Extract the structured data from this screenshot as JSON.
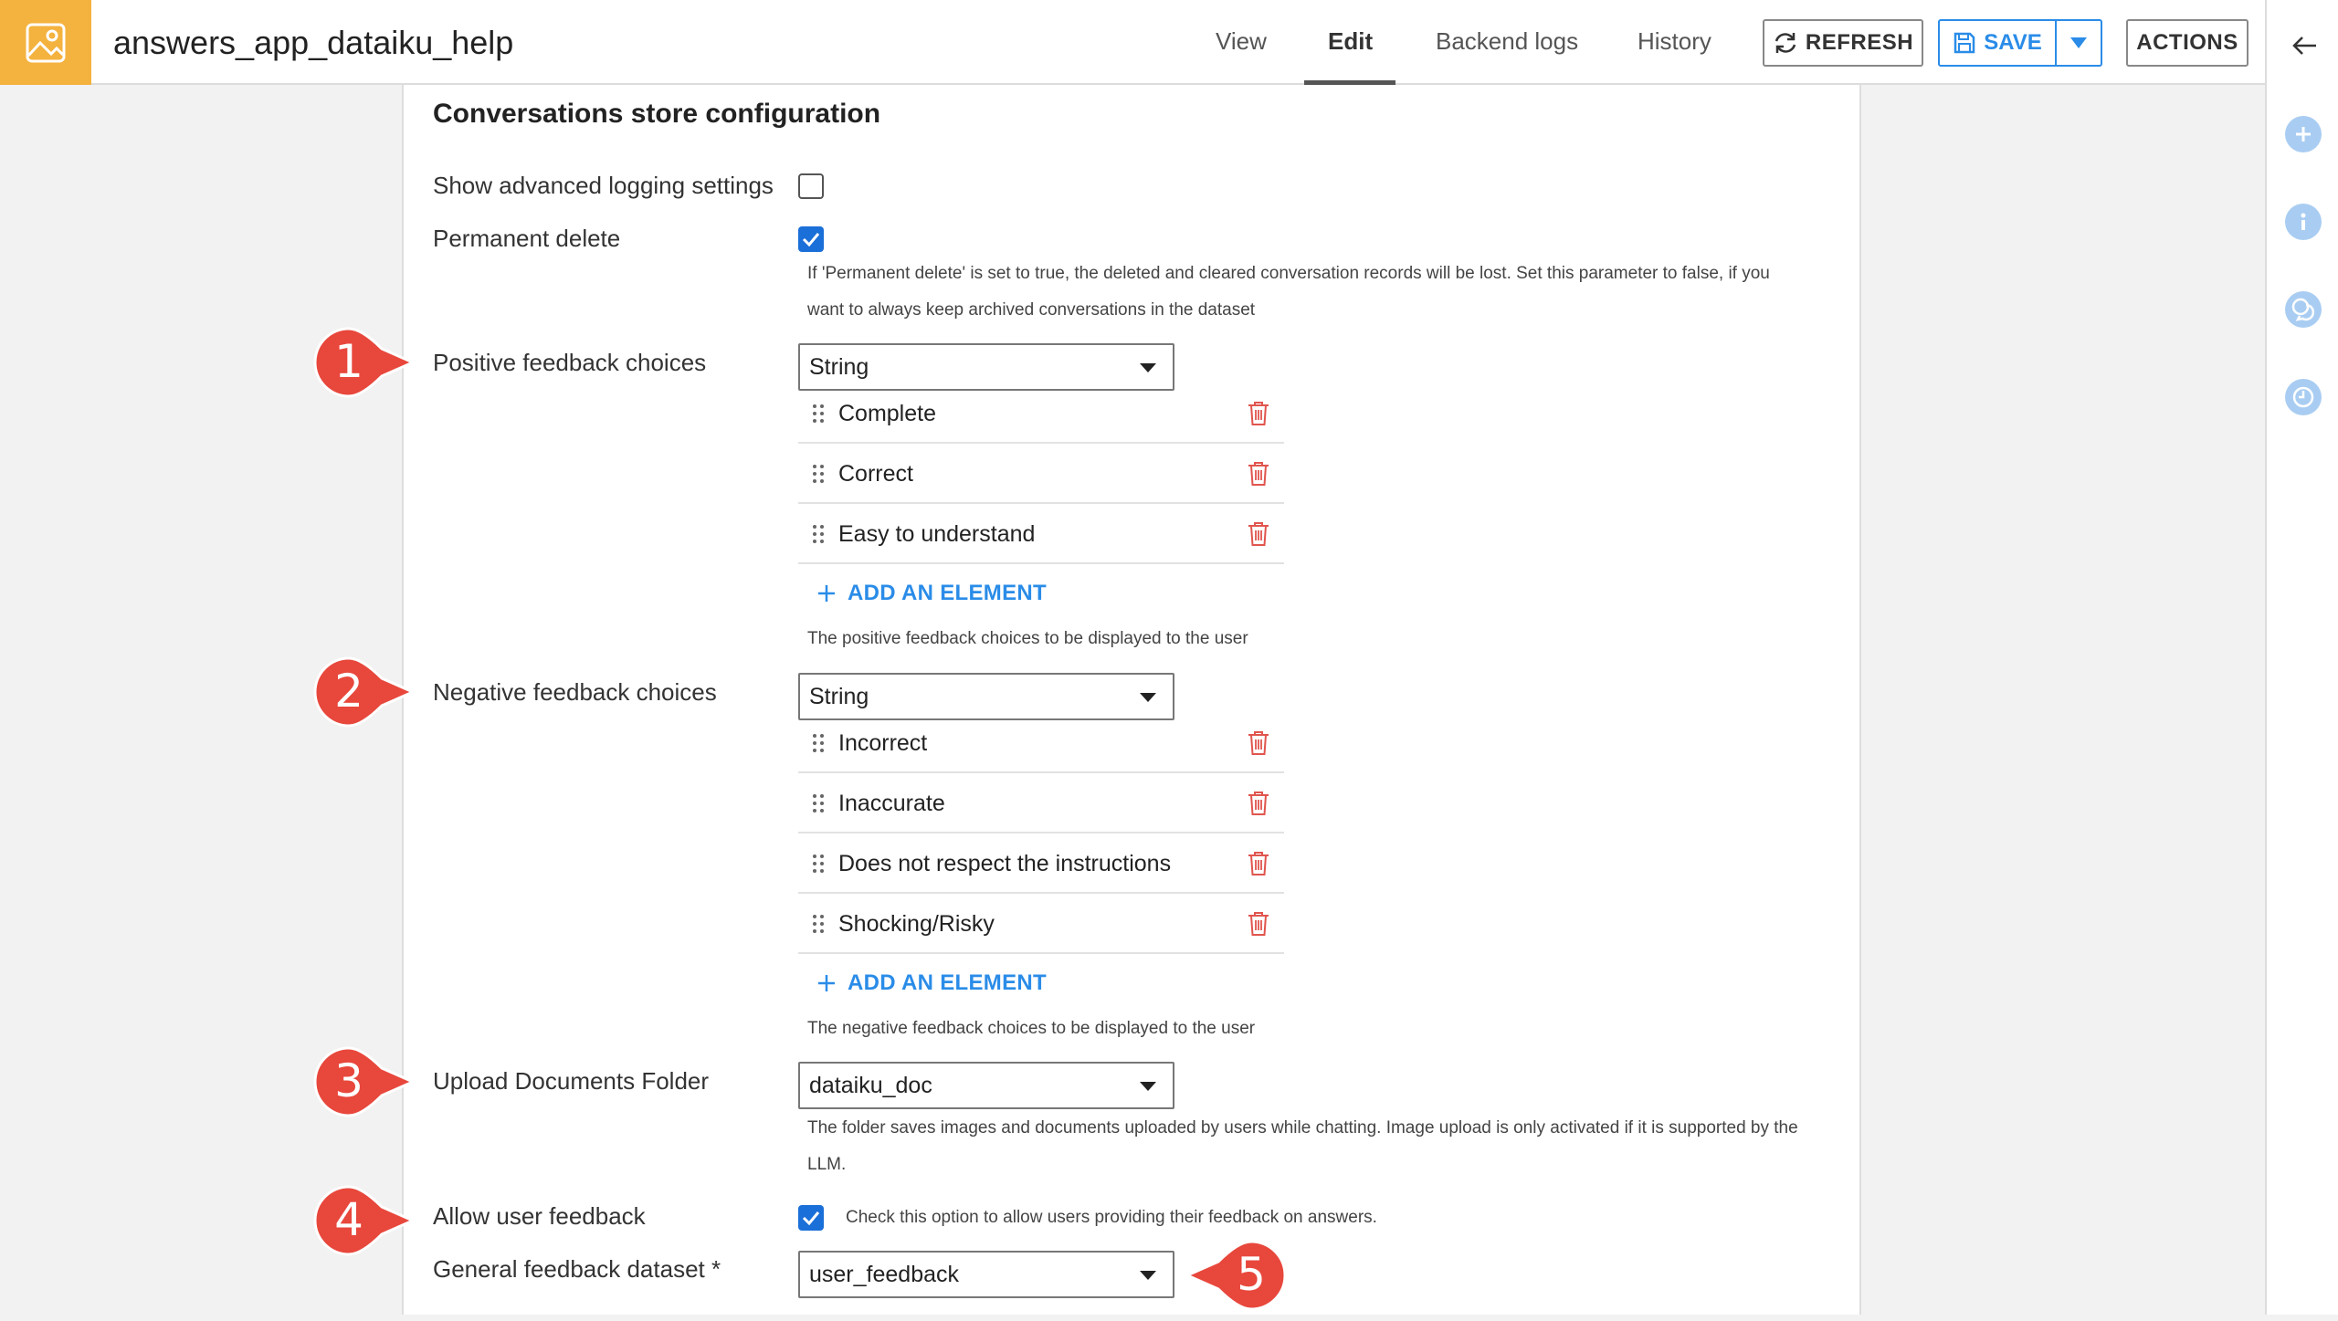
{
  "header": {
    "app_title": "answers_app_dataiku_help",
    "tabs": [
      {
        "label": "View"
      },
      {
        "label": "Edit"
      },
      {
        "label": "Backend logs"
      },
      {
        "label": "History"
      }
    ],
    "refresh_label": "REFRESH",
    "save_label": "SAVE",
    "actions_label": "ACTIONS"
  },
  "section": {
    "title": "Conversations store configuration"
  },
  "fields": {
    "advanced_logging": {
      "label": "Show advanced logging settings",
      "checked": false
    },
    "permanent_delete": {
      "label": "Permanent delete",
      "checked": true,
      "help_line1": "If 'Permanent delete' is set to true, the deleted and cleared conversation records will be lost. Set this parameter to false, if you",
      "help_line2": "want to always keep archived conversations in the dataset"
    },
    "positive_feedback": {
      "label": "Positive feedback choices",
      "type": "String",
      "items": [
        "Complete",
        "Correct",
        "Easy to understand"
      ],
      "add_label": "ADD AN ELEMENT",
      "help": "The positive feedback choices to be displayed to the user"
    },
    "negative_feedback": {
      "label": "Negative feedback choices",
      "type": "String",
      "items": [
        "Incorrect",
        "Inaccurate",
        "Does not respect the instructions",
        "Shocking/Risky"
      ],
      "add_label": "ADD AN ELEMENT",
      "help": "The negative feedback choices to be displayed to the user"
    },
    "upload_folder": {
      "label": "Upload Documents Folder",
      "value": "dataiku_doc",
      "help_line1": "The folder saves images and documents uploaded by users while chatting. Image upload is only activated if it is supported by the",
      "help_line2": "LLM."
    },
    "allow_feedback": {
      "label": "Allow user feedback",
      "checked": true,
      "help": "Check this option to allow users providing their feedback on answers."
    },
    "feedback_dataset": {
      "label": "General feedback dataset *",
      "value": "user_feedback"
    }
  },
  "callouts": [
    "1",
    "2",
    "3",
    "4",
    "5"
  ],
  "colors": {
    "accent": "#2a8ce8",
    "checkbox": "#1b6fd8",
    "app_icon_bg": "#f4b23e",
    "callout": "#e8473c",
    "trash": "#e0554e"
  }
}
